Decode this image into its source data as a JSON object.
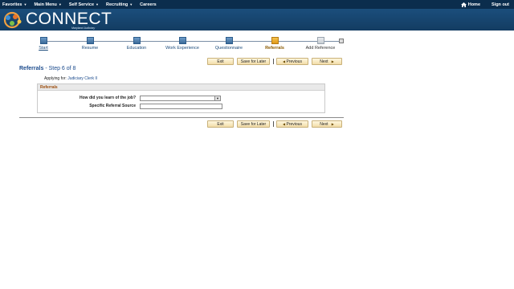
{
  "nav": {
    "items": [
      {
        "label": "Favorites"
      },
      {
        "label": "Main Menu"
      },
      {
        "label": "Self Service"
      },
      {
        "label": "Recruiting"
      },
      {
        "label": "Careers"
      }
    ],
    "home_label": "Home",
    "signout_label": "Sign out"
  },
  "logo": {
    "title": "CONNECT",
    "subtitle": "Maryland Judiciary"
  },
  "steps": [
    {
      "label": "Start"
    },
    {
      "label": "Resume"
    },
    {
      "label": "Education"
    },
    {
      "label": "Work Experience"
    },
    {
      "label": "Questionnaire"
    },
    {
      "label": "Referrals"
    },
    {
      "label": "Add Reference"
    }
  ],
  "buttons": {
    "exit": "Exit",
    "save_later": "Save for Later",
    "previous": "Previous",
    "next": "Next"
  },
  "page": {
    "title": "Referrals",
    "step_text": "- Step 6 of 8",
    "applying_label": "Applying for:",
    "job_title": "Judiciary Clerk II"
  },
  "form": {
    "section_title": "Referrals",
    "question_label": "How did you learn of the job?",
    "question_value": "",
    "source_label": "Specific Referral Source",
    "source_value": ""
  },
  "colors": {
    "nav_bg": "#0b2d4d",
    "banner_bg": "#1b4e7c",
    "current_step": "#e09a1a",
    "accent_text": "#1a4a8c"
  }
}
